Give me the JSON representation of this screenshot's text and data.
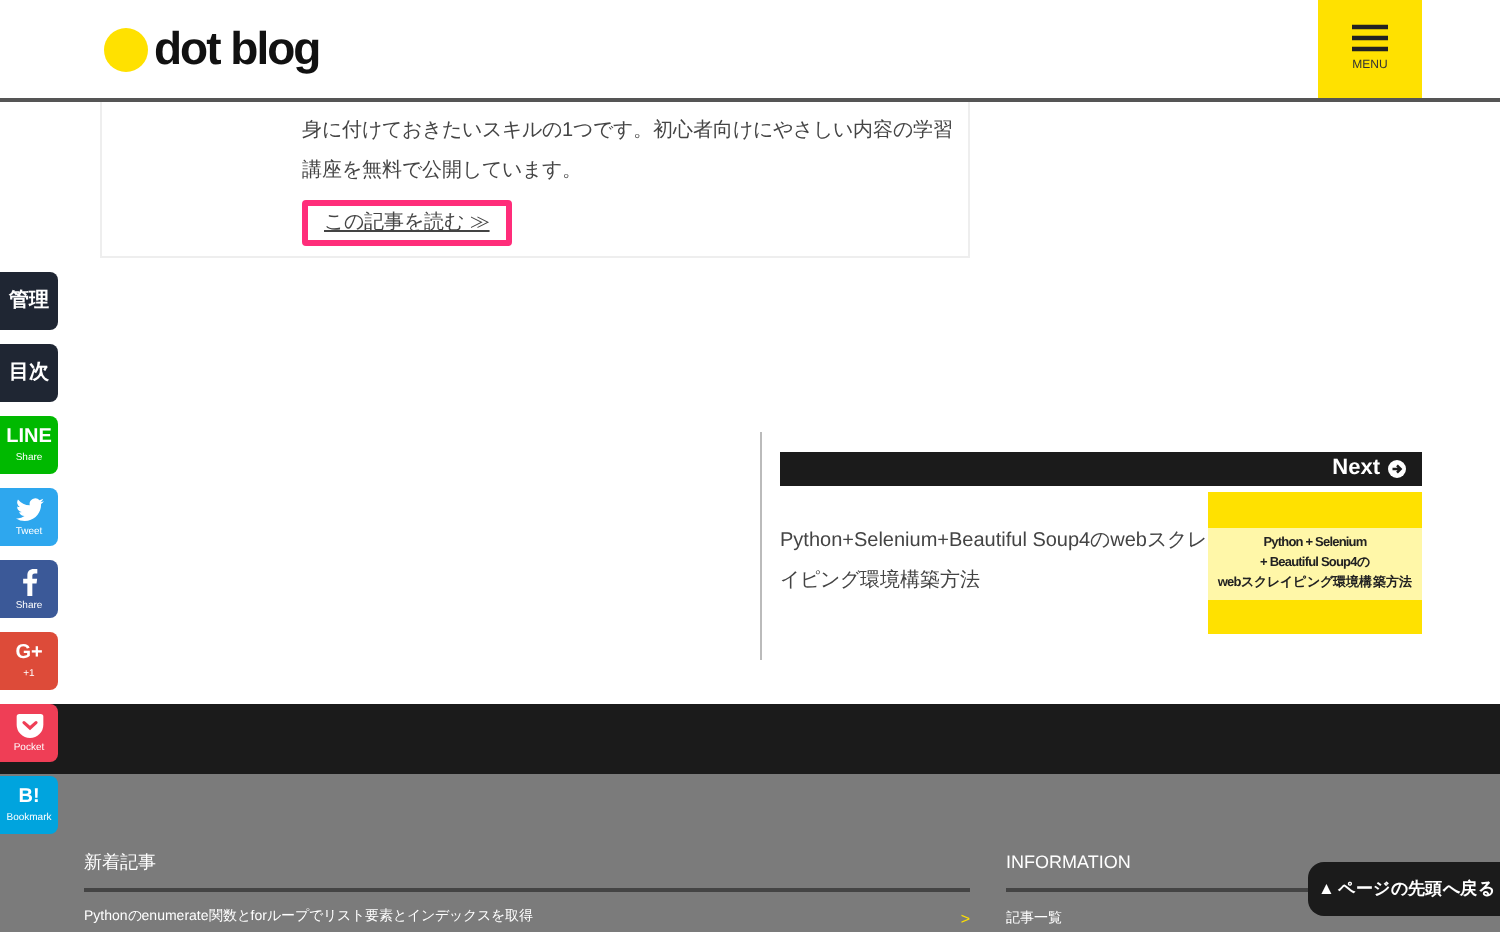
{
  "header": {
    "logo": "dot blog",
    "menu_label": "MENU"
  },
  "article_card": {
    "excerpt": [
      "身に付けておきたいスキルの1つです。初心者向けにやさしい内容の学習",
      "講座を無料で公開しています。"
    ],
    "read_more": "この記事を読む ≫"
  },
  "side_buttons": [
    {
      "kind": "text",
      "label": "管理",
      "color": "#1f2633"
    },
    {
      "kind": "text",
      "label": "目次",
      "color": "#1f2633"
    },
    {
      "kind": "line",
      "label": "LINE",
      "sub": "Share",
      "color": "#00b900"
    },
    {
      "kind": "twitter",
      "sub": "Tweet",
      "color": "#2ea7ee"
    },
    {
      "kind": "facebook",
      "sub": "Share",
      "color": "#3b5998"
    },
    {
      "kind": "google",
      "label": "G+",
      "sub": "+1",
      "color": "#dd4b39"
    },
    {
      "kind": "pocket",
      "sub": "Pocket",
      "color": "#ef3e56"
    },
    {
      "kind": "hatena",
      "label": "B!",
      "sub": "Bookmark",
      "color": "#00a4de"
    }
  ],
  "next_post": {
    "label": "Next",
    "title": "Python+Selenium+Beautiful Soup4のwebスクレイピング環境構築方法",
    "thumbnail_lines": [
      "Python + Selenium",
      "+ Beautiful Soup4の",
      "webスクレイピング環境構築方法"
    ]
  },
  "footer": {
    "recent": {
      "heading": "新着記事",
      "items": [
        {
          "title": "Pythonのenumerate関数とforループでリスト要素とインデックスを取得",
          "arrow": ">"
        }
      ]
    },
    "information": {
      "heading": "INFORMATION",
      "items": [
        "記事一覧"
      ]
    }
  },
  "back_to_top": "▲ ページの先頭へ戻る"
}
